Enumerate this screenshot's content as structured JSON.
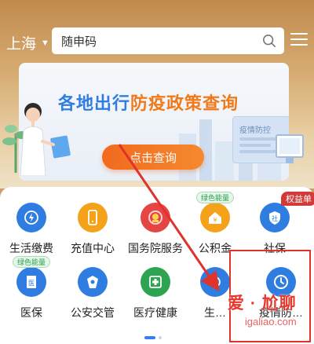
{
  "header": {
    "city": "上海",
    "search_placeholder": "随申码",
    "icons": {
      "search": "search-icon",
      "menu": "menu-icon",
      "caret": "caret-down-icon"
    }
  },
  "banner": {
    "title_part1": "各地出行",
    "title_part2": "防疫政策查询",
    "board_label": "疫情防控",
    "button_label": "点击查询"
  },
  "grid": {
    "items": [
      {
        "label": "生活缴费",
        "icon": "lightning-icon",
        "color": "#2f7de0"
      },
      {
        "label": "充值中心",
        "icon": "phone-icon",
        "color": "#f5a21b"
      },
      {
        "label": "国务院服务",
        "icon": "emblem-icon",
        "color": "#e64545"
      },
      {
        "label": "公积金",
        "icon": "house-yuan-icon",
        "color": "#f5a21b",
        "badge": "绿色能量"
      },
      {
        "label": "社保",
        "icon": "shield-icon",
        "color": "#2f7de0",
        "badge": "权益单"
      },
      {
        "label": "医保",
        "icon": "medical-doc-icon",
        "color": "#2f7de0",
        "badge": "绿色能量"
      },
      {
        "label": "公安交管",
        "icon": "police-icon",
        "color": "#2f7de0"
      },
      {
        "label": "医疗健康",
        "icon": "cross-icon",
        "color": "#2ea352"
      },
      {
        "label": "生…",
        "icon": "service-icon",
        "color": "#2f7de0"
      },
      {
        "label": "疫情防…",
        "icon": "clock-icon",
        "color": "#2f7de0"
      }
    ]
  },
  "watermark": {
    "line1": "爱 · 尬聊",
    "line2": "igaliao.com"
  },
  "colors": {
    "header": "#c9a06a",
    "accent_blue": "#2f7de0",
    "accent_orange": "#f26a1e",
    "annotation_red": "#e0332c"
  }
}
